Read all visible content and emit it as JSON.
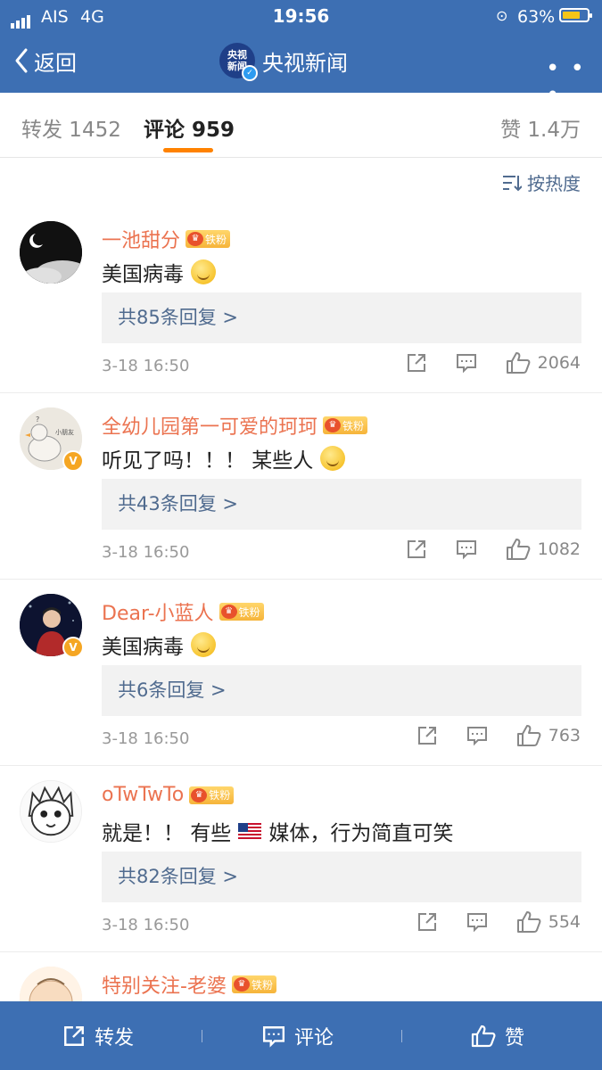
{
  "status_bar": {
    "carrier": "AIS",
    "network": "4G",
    "time": "19:56",
    "battery": "63%",
    "battery_fraction": 0.63
  },
  "nav": {
    "back_label": "返回",
    "logo_text_line1": "央视",
    "logo_text_line2": "新闻",
    "title": "央视新闻",
    "more_label": "• • •"
  },
  "tabs": [
    {
      "label": "转发 1452"
    },
    {
      "label": "评论 959",
      "active": true
    },
    {
      "label": "赞 1.4万"
    }
  ],
  "sort_label": "按热度",
  "comments": [
    {
      "user": "一池甜分",
      "badge": "铁粉",
      "text": "美国病毒",
      "replies": "共85条回复 >",
      "time": "3-18 16:50",
      "likes": "2064",
      "verified": false
    },
    {
      "user": "全幼儿园第一可爱的珂珂",
      "badge": "铁粉",
      "text": "听见了吗！！！ 某些人",
      "replies": "共43条回复 >",
      "time": "3-18 16:50",
      "likes": "1082",
      "verified": true
    },
    {
      "user": "Dear-小蓝人",
      "badge": "铁粉",
      "text": "美国病毒",
      "replies": "共6条回复 >",
      "time": "3-18 16:50",
      "likes": "763",
      "verified": true
    },
    {
      "user": "oTwTwTo",
      "badge": "铁粉",
      "text_before": "就是！！ 有些",
      "text_after": "媒体，行为简直可笑",
      "replies": "共82条回复 >",
      "time": "3-18 16:50",
      "likes": "554",
      "verified": false
    },
    {
      "user": "特别关注-老婆",
      "badge": "铁粉"
    }
  ],
  "bottom_bar": {
    "repost": "转发",
    "comment": "评论",
    "like": "赞"
  },
  "colors": {
    "header_bg": "#3d6fb3",
    "username": "#eb7350",
    "accent": "#ff8200",
    "link": "#506b8f"
  }
}
